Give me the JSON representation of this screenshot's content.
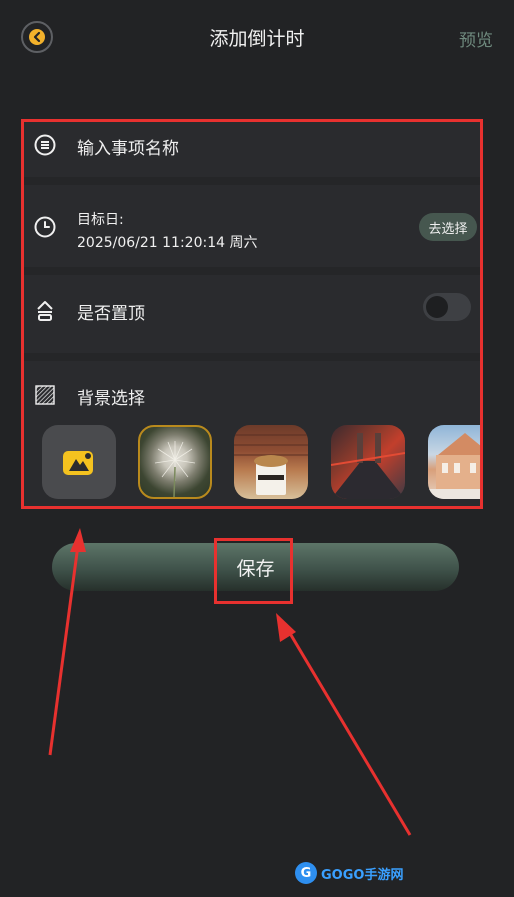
{
  "header": {
    "title": "添加倒计时",
    "preview_label": "预览",
    "back_icon": "chevron-left-icon"
  },
  "form": {
    "name_placeholder": "输入事项名称",
    "target_date_label": "目标日:",
    "target_date_value": "2025/06/21 11:20:14 周六",
    "choose_button": "去选择",
    "pin_top_label": "是否置顶",
    "pin_top_enabled": false,
    "background_label": "背景选择"
  },
  "backgrounds": [
    {
      "name": "add-image",
      "selected": false
    },
    {
      "name": "dandelion",
      "selected": true
    },
    {
      "name": "coffee-cup",
      "selected": false
    },
    {
      "name": "bridge",
      "selected": false
    },
    {
      "name": "building",
      "selected": false
    }
  ],
  "save_label": "保存",
  "watermark": "GOGO手游网",
  "colors": {
    "background": "#222325",
    "accent": "#46574f",
    "highlight": "#e8312f",
    "back_icon": "#f2b12b"
  }
}
